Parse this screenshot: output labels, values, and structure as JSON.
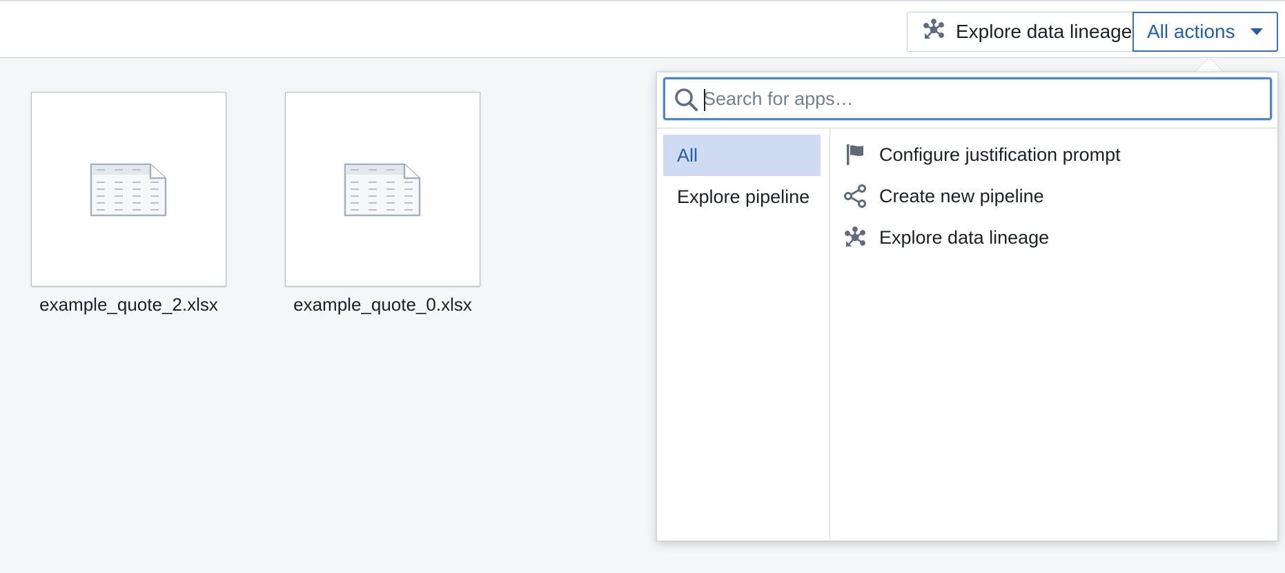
{
  "toolbar": {
    "lineage_button_label": "Explore data lineage",
    "lineage_button_icon": "data-lineage-icon",
    "actions_button_label": "All actions",
    "actions_button_icon": "caret-down-icon",
    "accent_color": "#2d72d2"
  },
  "files": [
    {
      "name": "example_quote_2.xlsx",
      "icon": "spreadsheet-icon"
    },
    {
      "name": "example_quote_0.xlsx",
      "icon": "spreadsheet-icon"
    }
  ],
  "actions_menu": {
    "search": {
      "placeholder": "Search for apps…",
      "value": "",
      "icon": "search-icon"
    },
    "categories": [
      {
        "label": "All",
        "selected": true
      },
      {
        "label": "Explore pipeline",
        "selected": false
      }
    ],
    "apps": [
      {
        "label": "Configure justification prompt",
        "icon": "flag-icon"
      },
      {
        "label": "Create new pipeline",
        "icon": "pipeline-icon"
      },
      {
        "label": "Explore data lineage",
        "icon": "data-lineage-icon"
      }
    ],
    "selected_category_bg": "#cfdbf2"
  }
}
